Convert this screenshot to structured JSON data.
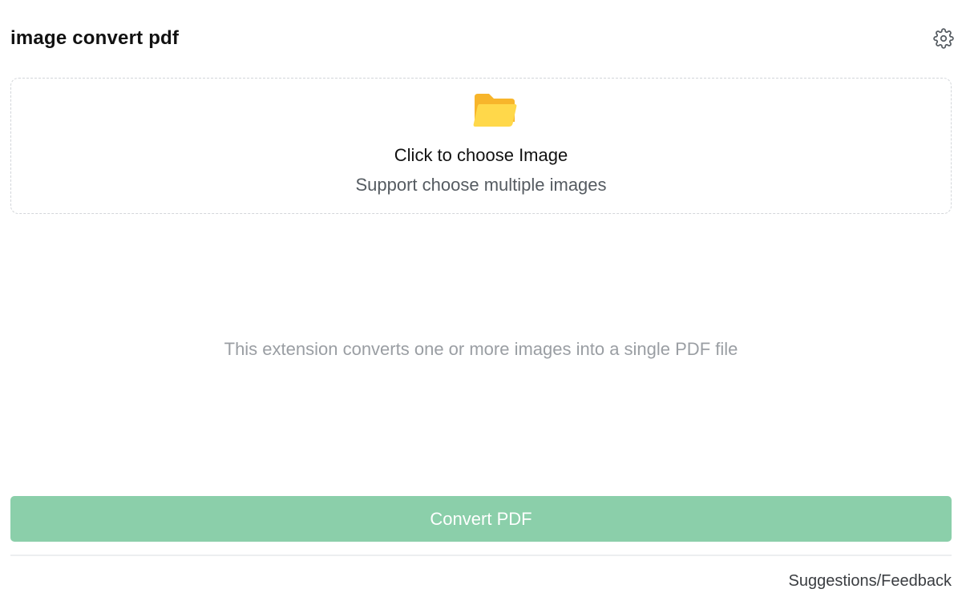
{
  "header": {
    "title": "image convert pdf",
    "settings_icon": "gear-icon"
  },
  "upload": {
    "icon": "folder-icon",
    "title": "Click to choose Image",
    "subtitle": "Support choose multiple images"
  },
  "description": "This extension converts one or more images into a single PDF file",
  "actions": {
    "convert_label": "Convert PDF",
    "convert_color": "#8bcfaa"
  },
  "footer": {
    "feedback_label": "Suggestions/Feedback"
  },
  "colors": {
    "folder_back": "#f7b52b",
    "folder_front": "#ffd84a"
  }
}
